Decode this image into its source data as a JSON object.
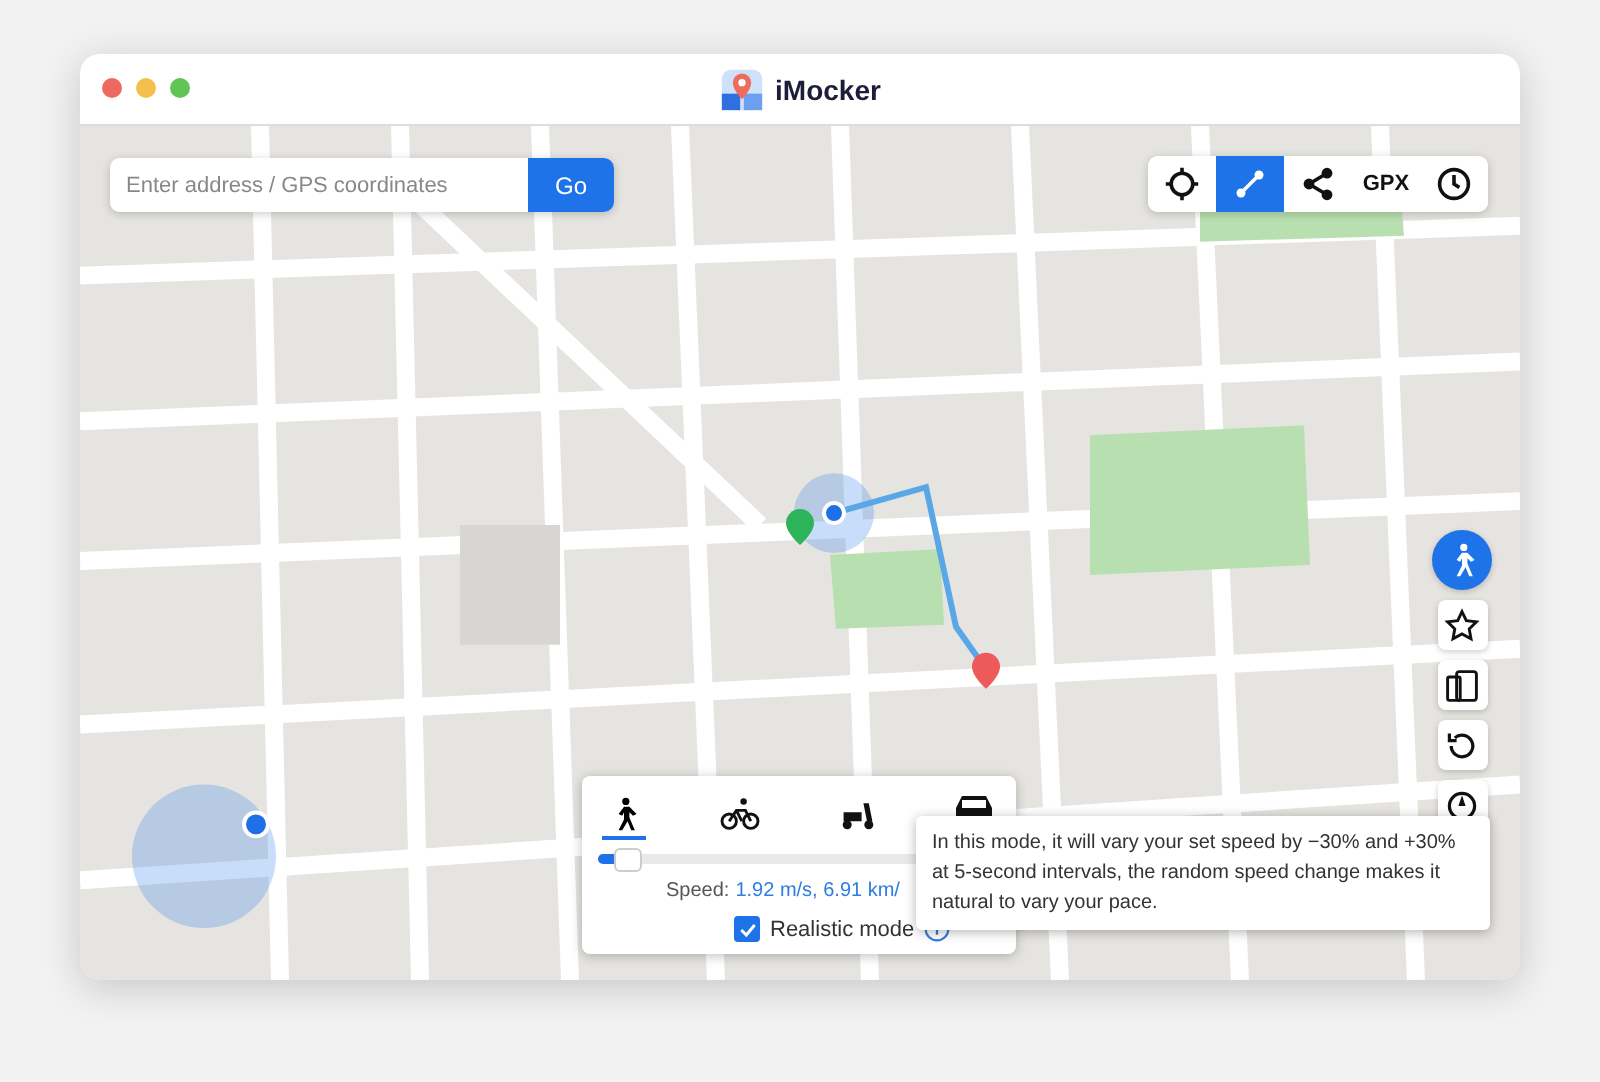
{
  "window": {
    "title": "iMocker"
  },
  "search": {
    "placeholder": "Enter address / GPS coordinates",
    "button": "Go"
  },
  "toolbar": [
    {
      "kind": "crosshair",
      "selected": false
    },
    {
      "kind": "route",
      "selected": true
    },
    {
      "kind": "share",
      "selected": false
    },
    {
      "kind": "text",
      "label": "GPX",
      "selected": false
    },
    {
      "kind": "clock",
      "selected": false
    }
  ],
  "side_tools": [
    {
      "kind": "walk",
      "selected": true
    },
    {
      "kind": "star",
      "selected": false
    },
    {
      "kind": "phones",
      "selected": false
    },
    {
      "kind": "reset",
      "selected": false
    },
    {
      "kind": "compass",
      "selected": false
    }
  ],
  "speed_panel": {
    "modes": [
      {
        "kind": "walk",
        "selected": true
      },
      {
        "kind": "bike",
        "selected": false
      },
      {
        "kind": "scooter",
        "selected": false
      },
      {
        "kind": "car",
        "selected": false
      }
    ],
    "level": 0.05,
    "speed_label": "Speed:",
    "speed_value": "1.92 m/s, 6.91 km/",
    "realistic_mode": {
      "label": "Realistic mode",
      "checked": true
    }
  },
  "tooltip": "In this mode, it will vary your set speed by −30% and +30% at 5-second intervals, the random speed change makes it natural to vary your pace."
}
